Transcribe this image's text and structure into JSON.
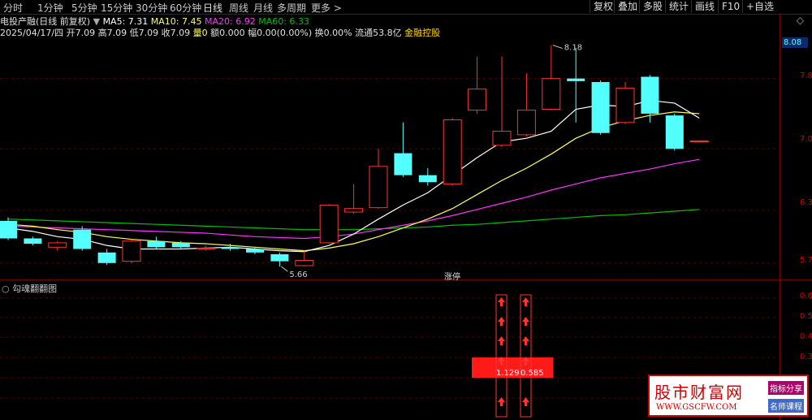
{
  "periods": [
    "分时",
    "1分钟",
    "5分钟",
    "15分钟",
    "30分钟",
    "60分钟",
    "日线",
    "周线",
    "月线",
    "多周期",
    "更多 >"
  ],
  "active_period": "日线",
  "tools": [
    "复权",
    "叠加",
    "多股",
    "统计",
    "画线",
    "F10",
    "+自选"
  ],
  "title_line": {
    "stock": "电投产融(日线 前复权)",
    "ma5": "MA5: 7.31",
    "ma10": "MA10: 7.45",
    "ma20": "MA20: 6.92",
    "ma60": "MA60: 6.33"
  },
  "quote_line": {
    "date": "2025/04/17/四",
    "open": "开7.09",
    "high": "高7.09",
    "low": "低7.09",
    "close": "收7.09",
    "volume": "量0",
    "amount": "额0.000",
    "change": "幅0.00(0.00%)",
    "turnover": "换0.00%",
    "float": "流通53.8亿",
    "tag": "金融控股"
  },
  "price_axis": [
    "7.8",
    "7.0",
    "6.3",
    "5.7"
  ],
  "current_price": "8.08",
  "annotations": {
    "high": "8.18",
    "low": "5.66",
    "limit_up": "涨停"
  },
  "indicator": {
    "name": "勾魂翻翻图",
    "axis": [
      "0.6",
      "0.5",
      "0.4",
      "0.3"
    ],
    "values": [
      "1.129",
      "0.585"
    ]
  },
  "watermark": {
    "name": "股市财富网",
    "url": "WWW.GSCFW.COM",
    "tag1": "指标分享",
    "tag2": "名师课程"
  },
  "colors": {
    "up": "#ff3232",
    "down": "#54ffff",
    "ma5": "#ffffff",
    "ma10": "#ffff55",
    "ma20": "#ff33ff",
    "ma60": "#00c000"
  },
  "chart_data": {
    "type": "candlestick",
    "ylim": [
      5.55,
      8.25
    ],
    "candles": [
      {
        "o": 6.18,
        "c": 5.98,
        "h": 6.22,
        "l": 5.96
      },
      {
        "o": 5.98,
        "c": 5.92,
        "h": 6.0,
        "l": 5.9
      },
      {
        "o": 5.88,
        "c": 5.93,
        "h": 5.95,
        "l": 5.84
      },
      {
        "o": 6.08,
        "c": 5.86,
        "h": 6.12,
        "l": 5.84
      },
      {
        "o": 5.82,
        "c": 5.7,
        "h": 5.86,
        "l": 5.68
      },
      {
        "o": 5.72,
        "c": 5.95,
        "h": 5.97,
        "l": 5.7
      },
      {
        "o": 5.95,
        "c": 5.88,
        "h": 6.0,
        "l": 5.86
      },
      {
        "o": 5.93,
        "c": 5.88,
        "h": 5.95,
        "l": 5.86
      },
      {
        "o": 5.86,
        "c": 5.87,
        "h": 5.9,
        "l": 5.84
      },
      {
        "o": 5.88,
        "c": 5.86,
        "h": 5.92,
        "l": 5.84
      },
      {
        "o": 5.86,
        "c": 5.82,
        "h": 5.88,
        "l": 5.8
      },
      {
        "o": 5.8,
        "c": 5.72,
        "h": 5.82,
        "l": 5.66
      },
      {
        "o": 5.67,
        "c": 5.73,
        "h": 5.84,
        "l": 5.66
      },
      {
        "o": 5.93,
        "c": 6.36,
        "h": 6.37,
        "l": 5.92
      },
      {
        "o": 6.28,
        "c": 6.32,
        "h": 6.6,
        "l": 6.26
      },
      {
        "o": 6.33,
        "c": 6.8,
        "h": 7.0,
        "l": 6.32
      },
      {
        "o": 6.95,
        "c": 6.7,
        "h": 7.3,
        "l": 6.68
      },
      {
        "o": 6.7,
        "c": 6.62,
        "h": 6.78,
        "l": 6.58
      },
      {
        "o": 6.6,
        "c": 7.33,
        "h": 7.35,
        "l": 6.58
      },
      {
        "o": 7.44,
        "c": 7.68,
        "h": 8.05,
        "l": 7.4
      },
      {
        "o": 7.04,
        "c": 7.2,
        "h": 8.05,
        "l": 7.02
      },
      {
        "o": 7.16,
        "c": 7.44,
        "h": 7.86,
        "l": 7.14
      },
      {
        "o": 7.45,
        "c": 7.8,
        "h": 8.18,
        "l": 7.44
      },
      {
        "o": 7.8,
        "c": 7.77,
        "h": 8.15,
        "l": 7.3
      },
      {
        "o": 7.76,
        "c": 7.18,
        "h": 7.78,
        "l": 7.16
      },
      {
        "o": 7.3,
        "c": 7.69,
        "h": 7.76,
        "l": 7.28
      },
      {
        "o": 7.82,
        "c": 7.4,
        "h": 7.84,
        "l": 7.3
      },
      {
        "o": 7.38,
        "c": 7.0,
        "h": 7.4,
        "l": 6.98
      },
      {
        "o": 7.09,
        "c": 7.09,
        "h": 7.09,
        "l": 7.09
      }
    ],
    "ma5": [
      6.1,
      6.06,
      6.0,
      5.97,
      5.9,
      5.86,
      5.86,
      5.86,
      5.87,
      5.88,
      5.86,
      5.84,
      5.83,
      5.9,
      6.03,
      6.2,
      6.36,
      6.5,
      6.7,
      6.9,
      7.08,
      7.12,
      7.2,
      7.45,
      7.5,
      7.48,
      7.55,
      7.52,
      7.35
    ],
    "ma10": [
      6.14,
      6.12,
      6.08,
      6.05,
      6.0,
      5.97,
      5.95,
      5.93,
      5.92,
      5.9,
      5.88,
      5.86,
      5.84,
      5.87,
      5.92,
      6.0,
      6.1,
      6.2,
      6.32,
      6.48,
      6.64,
      6.78,
      6.94,
      7.12,
      7.24,
      7.32,
      7.38,
      7.42,
      7.4
    ],
    "ma20": [
      6.12,
      6.11,
      6.1,
      6.09,
      6.08,
      6.07,
      6.06,
      6.05,
      6.04,
      6.02,
      6.0,
      5.99,
      5.98,
      6.0,
      6.03,
      6.08,
      6.13,
      6.18,
      6.24,
      6.31,
      6.38,
      6.45,
      6.53,
      6.6,
      6.67,
      6.72,
      6.77,
      6.83,
      6.88
    ],
    "ma60": [
      6.2,
      6.19,
      6.18,
      6.17,
      6.16,
      6.15,
      6.14,
      6.13,
      6.12,
      6.11,
      6.1,
      6.09,
      6.08,
      6.08,
      6.08,
      6.09,
      6.1,
      6.11,
      6.13,
      6.14,
      6.16,
      6.18,
      6.2,
      6.22,
      6.24,
      6.25,
      6.27,
      6.29,
      6.31
    ],
    "signals": [
      {
        "index": 20,
        "type": "up-arrows"
      },
      {
        "index": 21,
        "type": "up-arrows"
      }
    ]
  }
}
